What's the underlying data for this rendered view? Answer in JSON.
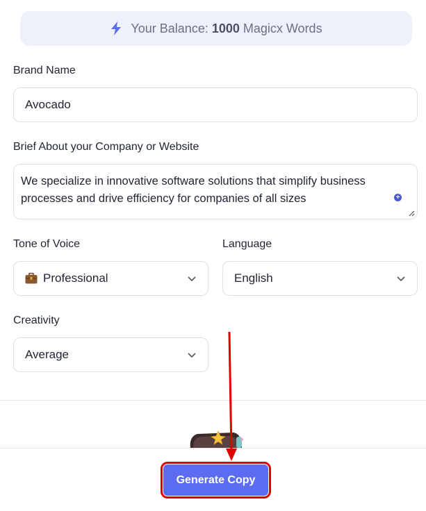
{
  "balance": {
    "prefix": "Your Balance:",
    "amount": "1000",
    "suffix": "Magicx Words",
    "icon": "lightning-bolt-icon"
  },
  "form": {
    "brand_name": {
      "label": "Brand Name",
      "value": "Avocado"
    },
    "brief": {
      "label": "Brief About your Company or Website",
      "value": "We specialize in innovative software solutions that simplify business processes and drive efficiency for companies of all sizes"
    },
    "tone": {
      "label": "Tone of Voice",
      "value": "Professional",
      "icon": "briefcase-emoji"
    },
    "language": {
      "label": "Language",
      "value": "English"
    },
    "creativity": {
      "label": "Creativity",
      "value": "Average"
    }
  },
  "actions": {
    "generate_label": "Generate Copy"
  },
  "colors": {
    "accent": "#5b6cf0",
    "highlight": "#e00000",
    "balance_bg": "#eef0fc"
  }
}
